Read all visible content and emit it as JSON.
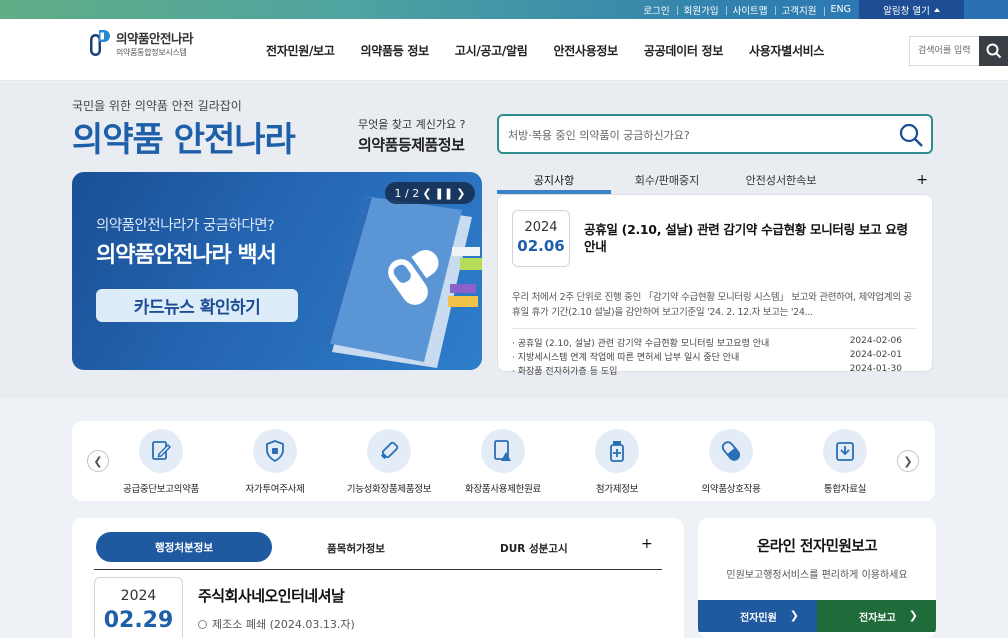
{
  "utility": {
    "links": [
      "로그인",
      "회원가입",
      "사이트맵",
      "고객지원",
      "ENG"
    ],
    "alert_toggle": "알림창 열기"
  },
  "header": {
    "logo_main": "의약품안전나라",
    "logo_sub": "의약품통합정보시스템",
    "nav": [
      "전자민원/보고",
      "의약품등 정보",
      "고시/공고/알림",
      "안전사용정보",
      "공공데이터 정보",
      "사용자별서비스"
    ],
    "search_placeholder": "검색어를 입력"
  },
  "hero": {
    "slogan": "국민을 위한 의약품 안전 길라잡이",
    "brand_title": "의약품 안전나라",
    "ask_line1": "무엇을 찾고 계신가요 ?",
    "ask_line2": "의약품등제품정보",
    "search_placeholder": "처방·복용 중인 의약품이 궁금하신가요?"
  },
  "banner": {
    "question": "의약품안전나라가 궁금하다면?",
    "title": "의약품안전나라 백서",
    "button": "카드뉴스 확인하기",
    "pager": "1 / 2"
  },
  "notice": {
    "tabs": [
      "공지사항",
      "회수/판매중지",
      "안전성서한속보"
    ],
    "plus": "+",
    "featured": {
      "year": "2024",
      "date": "02.06",
      "title": "공휴일 (2.10, 설날) 관련 감기약 수급현황 모니터링 보고 요령 안내",
      "summary": "우리 처에서 2주 단위로 진행 중인 「감기약 수급현황 모니터링 시스템」 보고와 관련하여, 제약업계의 공휴일 휴가 기간(2.10 설날)을 감안하여 보고기준일 '24. 2. 12.자 보고는 '24..."
    },
    "items": [
      {
        "title": "공휴일 (2.10, 설날) 관련 감기약 수급현황 모니터링 보고요령 안내",
        "date": "2024-02-06"
      },
      {
        "title": "지방세시스템 연계 작업에 따른 면허세 납부 일시 중단 안내",
        "date": "2024-02-01"
      },
      {
        "title": "화장품 전자허가증 등 도입",
        "date": "2024-01-30"
      }
    ]
  },
  "quick_menu": {
    "items": [
      "공급중단보고의약품",
      "자가투여주사제",
      "기능성화장품제품정보",
      "화장품사용제한원료",
      "첨가제정보",
      "의약품상호작용",
      "통합자료실"
    ]
  },
  "admin": {
    "tabs": [
      "행정처분정보",
      "품목허가정보",
      "DUR 성분고시"
    ],
    "plus": "+",
    "year": "2024",
    "date": "02.29",
    "company": "주식회사네오인터네셔날",
    "detail": "제조소 폐쇄 (2024.03.13.자)"
  },
  "online": {
    "title": "온라인 전자민원보고",
    "desc": "민원보고행정서비스를 편리하게 이용하세요",
    "btn_left": "전자민원",
    "btn_right": "전자보고",
    "color_left": "#1f5aa0",
    "color_right": "#1f6b3a"
  }
}
